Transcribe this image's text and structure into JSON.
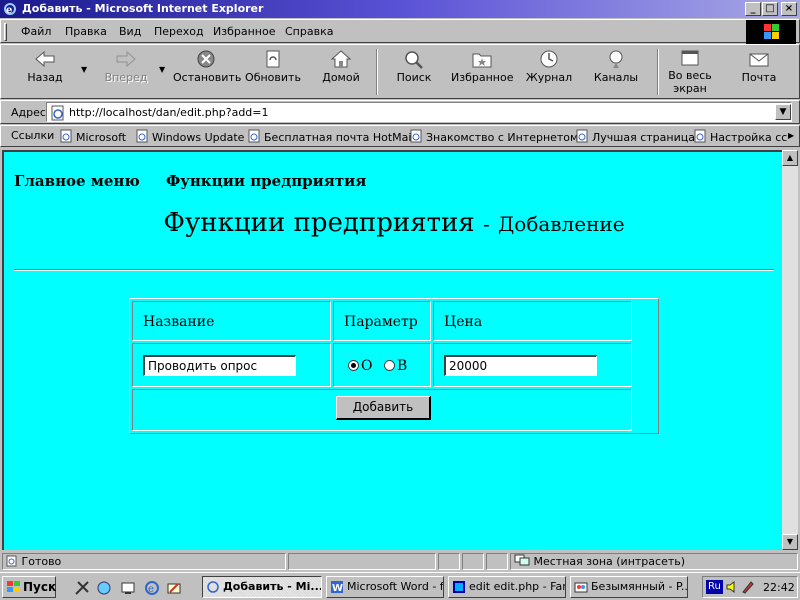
{
  "window": {
    "title": "Добавить - Microsoft Internet Explorer",
    "controls": {
      "minimize": "_",
      "maximize": "□",
      "close": "×"
    }
  },
  "menu": [
    "Файл",
    "Правка",
    "Вид",
    "Переход",
    "Избранное",
    "Справка"
  ],
  "toolbar": {
    "back": "Назад",
    "forward": "Вперед",
    "stop": "Остановить",
    "refresh": "Обновить",
    "home": "Домой",
    "search": "Поиск",
    "favorites": "Избранное",
    "history": "Журнал",
    "channels": "Каналы",
    "fullscreen_1": "Во весь",
    "fullscreen_2": "экран",
    "mail": "Почта"
  },
  "address": {
    "label": "Адрес",
    "url": "http://localhost/dan/edit.php?add=1"
  },
  "links": {
    "label": "Ссылки",
    "items": [
      "Microsoft",
      "Windows Update",
      "Бесплатная почта HotMail",
      "Знакомство с Интернетом",
      "Лучшая страница",
      "Настройка сс"
    ]
  },
  "page": {
    "nav": {
      "main_menu": "Главное меню",
      "functions": "Функции предприятия"
    },
    "heading": "Функции предприятия",
    "heading_separator": "-",
    "heading_sub": "Добавление",
    "form": {
      "col_name": "Название",
      "col_param": "Параметр",
      "col_price": "Цена",
      "name_value": "Проводить опрос",
      "radio_o": "O",
      "radio_b": "B",
      "selected_radio": "O",
      "price_value": "20000",
      "submit": "Добавить"
    }
  },
  "status": {
    "text": "Готово",
    "zone": "Местная зона (интрасеть)"
  },
  "taskbar": {
    "start": "Пуск",
    "tasks": [
      "Добавить - Mi...",
      "Microsoft Word - f...",
      "edit edit.php - Far",
      "Безымянный - P..."
    ],
    "lang": "Ru",
    "clock": "22:42"
  }
}
